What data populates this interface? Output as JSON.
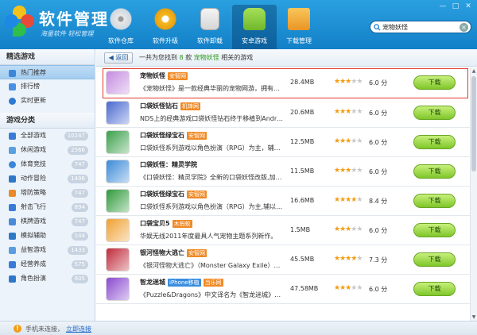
{
  "app": {
    "title": "软件管理",
    "subtitle": "海量软件 轻松管理"
  },
  "window": {
    "minimize": "—",
    "maximize": "□",
    "close": "✕"
  },
  "nav": [
    {
      "label": "软件仓库",
      "icon": "cd-icon",
      "color": "#f0f0f0"
    },
    {
      "label": "软件升级",
      "icon": "upgrade-icon",
      "color": "#f5b921"
    },
    {
      "label": "软件卸载",
      "icon": "recycle-bin-icon",
      "color": "#7dbf3a"
    },
    {
      "label": "安卓游戏",
      "icon": "android-icon",
      "color": "#8ccb3c",
      "active": true
    },
    {
      "label": "下载管理",
      "icon": "download-folder-icon",
      "color": "#f1a93a"
    }
  ],
  "search": {
    "value": "宠物妖怪",
    "placeholder": "",
    "clear": "×"
  },
  "sidebar": {
    "section1": "精选游戏",
    "featured": [
      {
        "label": "热门推荐",
        "icon": "hand-icon",
        "color": "#3d87d8",
        "active": true
      },
      {
        "label": "排行榜",
        "icon": "ranking-icon",
        "color": "#4a90e2"
      },
      {
        "label": "实时更新",
        "icon": "clock-icon",
        "color": "#2f7ad0"
      }
    ],
    "section2": "游戏分类",
    "categories": [
      {
        "label": "全部游戏",
        "count": "10247",
        "icon": "grid-icon",
        "color": "#3a7bd5"
      },
      {
        "label": "休闲游戏",
        "count": "2566",
        "icon": "leisure-icon",
        "color": "#5aa0e0"
      },
      {
        "label": "体育竞技",
        "count": "747",
        "icon": "sports-icon",
        "color": "#3a86d9"
      },
      {
        "label": "动作冒险",
        "count": "1406",
        "icon": "action-icon",
        "color": "#2f78c8"
      },
      {
        "label": "塔防策略",
        "count": "747",
        "icon": "tower-icon",
        "color": "#e88a2a"
      },
      {
        "label": "射击飞行",
        "count": "894",
        "icon": "plane-icon",
        "color": "#3a7bd5"
      },
      {
        "label": "棋牌游戏",
        "count": "747",
        "icon": "cards-icon",
        "color": "#4a8ad8"
      },
      {
        "label": "模拟辅助",
        "count": "144",
        "icon": "sim-icon",
        "color": "#2f78c8"
      },
      {
        "label": "益智游戏",
        "count": "1433",
        "icon": "puzzle-icon",
        "color": "#5b9de0"
      },
      {
        "label": "经营养成",
        "count": "575",
        "icon": "business-icon",
        "color": "#3a7bd5"
      },
      {
        "label": "角色扮演",
        "count": "605",
        "icon": "role-icon",
        "color": "#2f78c8"
      }
    ]
  },
  "toolbar": {
    "back": "返回",
    "summary_prefix": "一共为您找到",
    "count": "8",
    "summary_mid": "款",
    "keyword": "宠物妖怪",
    "summary_suffix": "相关的游戏"
  },
  "results": [
    {
      "name": "宠物妖怪",
      "tag": "安智网",
      "tag_color": "orange",
      "desc": "《宠物妖怪》是一款经典华丽的宠物网游，拥有精美...",
      "size": "28.4MB",
      "rating": 3,
      "score": "6.0 分",
      "download": "下载",
      "selected": true,
      "thumb": "#c58be0"
    },
    {
      "name": "口袋妖怪钻石",
      "tag": "机锋网",
      "tag_color": "orange",
      "desc": "NDS上的经典游戏口袋妖怪钻石终于移植到Android...",
      "size": "20.6MB",
      "rating": 3,
      "score": "6.0 分",
      "download": "下载",
      "thumb": "#4a6ad0"
    },
    {
      "name": "口袋妖怪绿宝石",
      "tag": "安智网",
      "tag_color": "orange",
      "desc": "口袋妖怪系列游戏以角色扮演（RPG）为主，辅以战略...",
      "size": "12.5MB",
      "rating": 3,
      "score": "6.0 分",
      "download": "下载",
      "thumb": "#3aa04a"
    },
    {
      "name": "口袋妖怪：精灵学院",
      "tag": "",
      "tag_color": "orange",
      "desc": "《口袋妖怪：精灵学院》全新的口袋妖怪改版,加入新...",
      "size": "11.5MB",
      "rating": 3,
      "score": "6.0 分",
      "download": "下载",
      "thumb": "#3a8ad8"
    },
    {
      "name": "口袋妖怪绿宝石",
      "tag": "安智网",
      "tag_color": "orange",
      "desc": "口袋妖怪系列游戏以角色扮演（RPG）为主,辅以战略...",
      "size": "16.6MB",
      "rating": 4,
      "score": "8.4 分",
      "download": "下载",
      "thumb": "#2e9a3a"
    },
    {
      "name": "口袋宝贝5",
      "tag": "木蚂蚁",
      "tag_color": "orange",
      "desc": "华娱无线2011年度最具人气宠物主题系列新作。",
      "size": "1.5MB",
      "rating": 3,
      "score": "6.0 分",
      "download": "下载",
      "thumb": "#f0a030"
    },
    {
      "name": "银河怪物大逃亡",
      "tag": "安智网",
      "tag_color": "orange",
      "desc": "《银河怪物大逃亡》（Monster Galaxy Exile）是一...",
      "size": "45.5MB",
      "rating": 4,
      "score": "7.3 分",
      "download": "下载",
      "thumb": "#c02a3a"
    },
    {
      "name": "智龙迷城",
      "tag": "iPhone移植",
      "tag_color": "blue",
      "tag2": "当乐网",
      "desc": "《Puzzle&Dragons》中文译名为《智龙迷城》或《...",
      "size": "47.58MB",
      "rating": 3,
      "score": "6.0 分",
      "download": "下载",
      "thumb": "#8a4ad0"
    }
  ],
  "status": {
    "text": "手机未连接，",
    "link": "立即连接"
  },
  "colors": {
    "header": "#1a8bd6",
    "accent_red": "#e03a2a",
    "star": "#f39c12",
    "download_green": "#7fc62a"
  }
}
